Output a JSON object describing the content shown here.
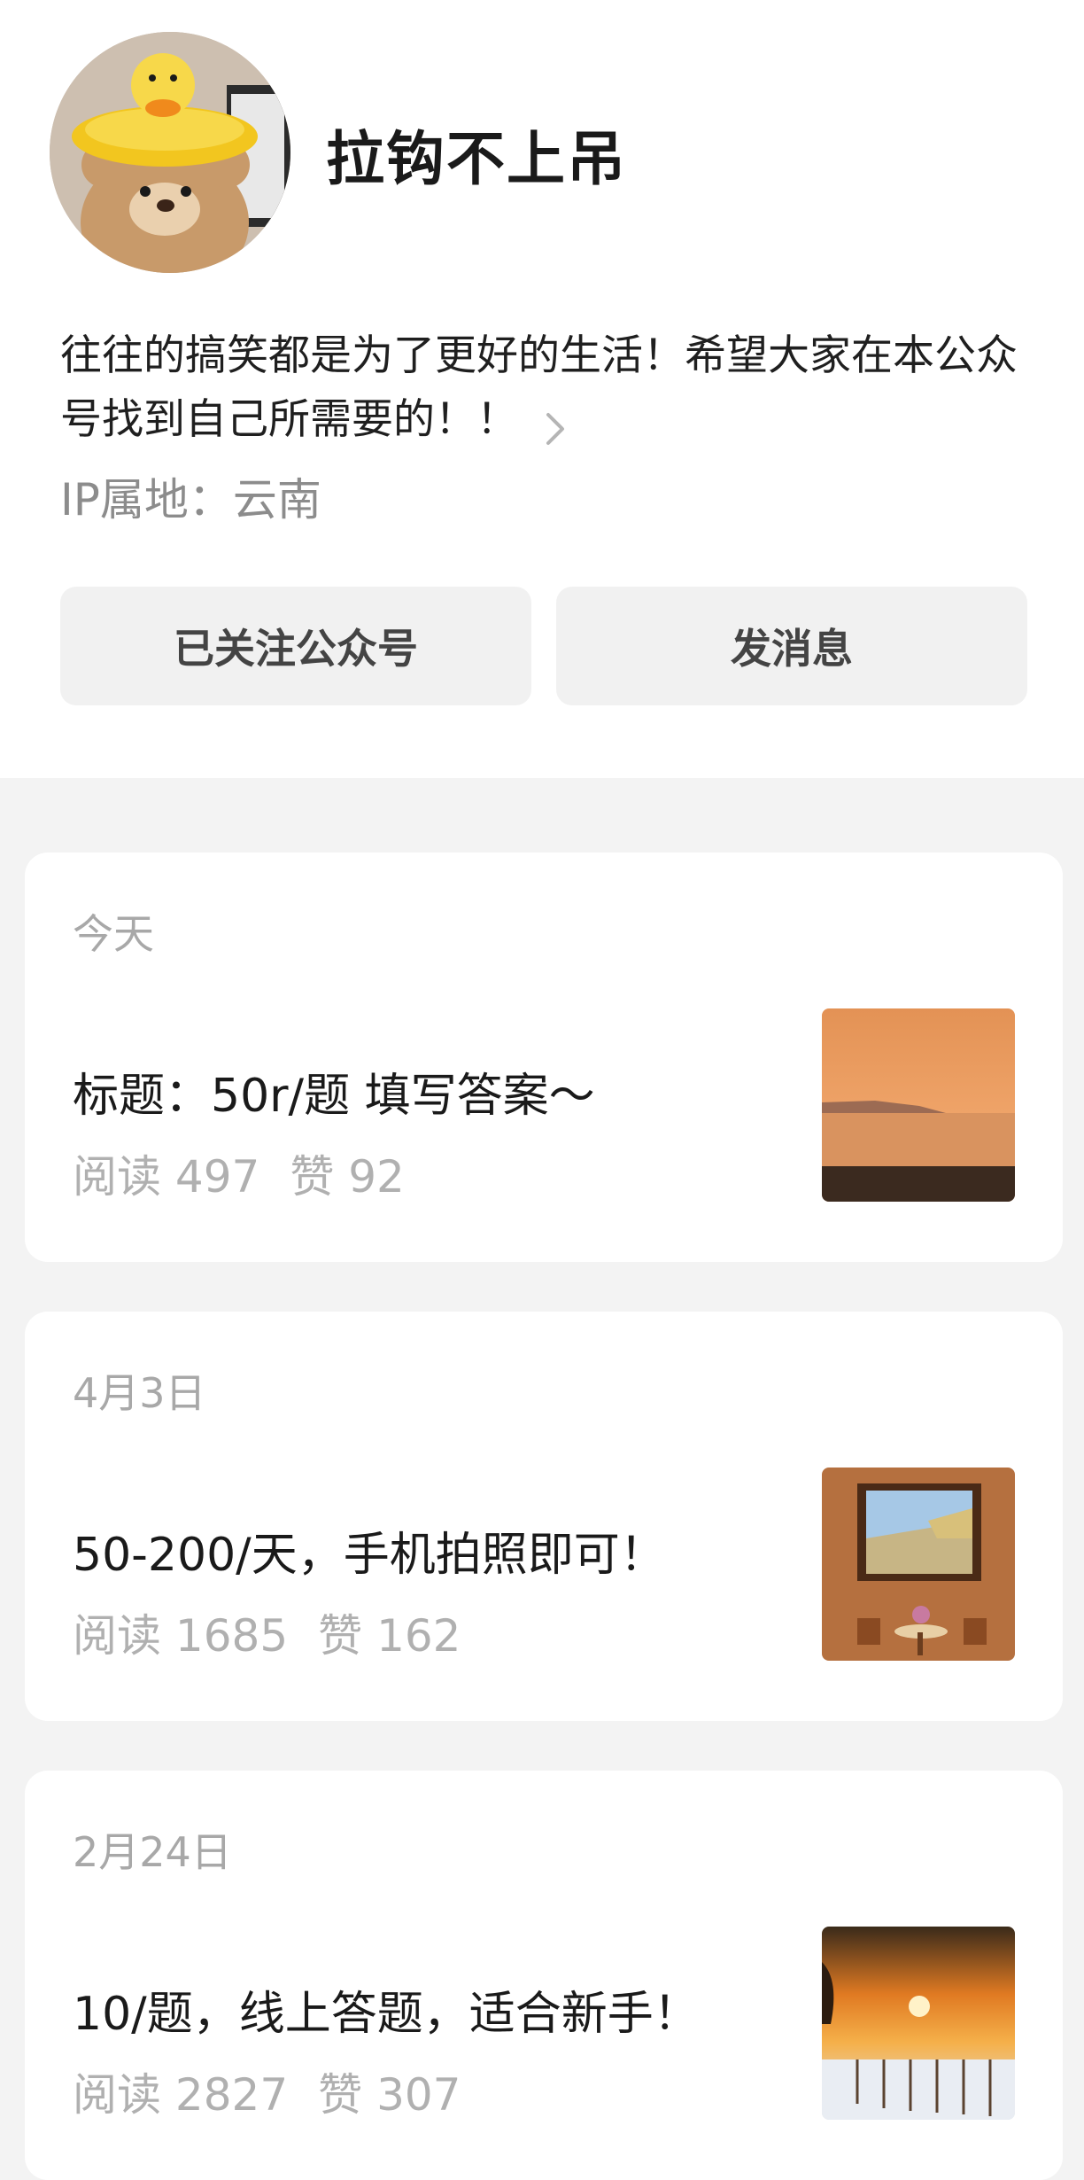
{
  "profile": {
    "name": "拉钩不上吊",
    "bio": "往往的搞笑都是为了更好的生活！希望大家在本公众号找到自己所需要的！！",
    "ip_label": "IP属地：",
    "ip_value": "云南"
  },
  "actions": {
    "follow_label": "已关注公众号",
    "message_label": "发消息"
  },
  "articles": [
    {
      "date": "今天",
      "title": "标题：50r/题 填写答案～",
      "read_label": "阅读",
      "read_count": "497",
      "like_label": "赞",
      "like_count": "92"
    },
    {
      "date": "4月3日",
      "title": "50-200/天，手机拍照即可！",
      "read_label": "阅读",
      "read_count": "1685",
      "like_label": "赞",
      "like_count": "162"
    },
    {
      "date": "2月24日",
      "title": "10/题，线上答题，适合新手！",
      "read_label": "阅读",
      "read_count": "2827",
      "like_label": "赞",
      "like_count": "307"
    }
  ]
}
